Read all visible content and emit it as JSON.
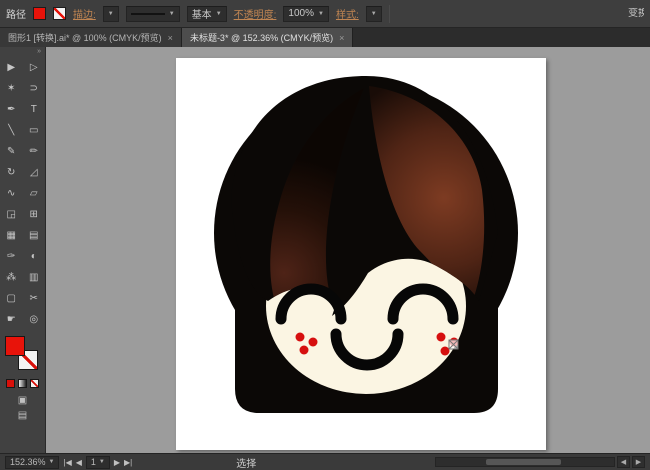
{
  "control_bar": {
    "selection_type": "路径",
    "stroke_label": "描边:",
    "brush_label": "基本",
    "opacity_label": "不透明度:",
    "opacity_value": "100%",
    "style_label": "样式:",
    "transform_label": "变换",
    "caret": "▼"
  },
  "tabs": [
    {
      "title": "图形1 [转换].ai* @ 100% (CMYK/预览)",
      "close": "×"
    },
    {
      "title": "未标题-3* @ 152.36% (CMYK/预览)",
      "close": "×"
    }
  ],
  "toolbar": {
    "collapse_glyph": "»",
    "tools": [
      {
        "name": "selection-tool",
        "glyph": "▶"
      },
      {
        "name": "direct-selection-tool",
        "glyph": "▷"
      },
      {
        "name": "magic-wand-tool",
        "glyph": "✶"
      },
      {
        "name": "lasso-tool",
        "glyph": "⊃"
      },
      {
        "name": "pen-tool",
        "glyph": "✒"
      },
      {
        "name": "type-tool",
        "glyph": "T"
      },
      {
        "name": "line-tool",
        "glyph": "╲"
      },
      {
        "name": "rectangle-tool",
        "glyph": "▭"
      },
      {
        "name": "paintbrush-tool",
        "glyph": "✎"
      },
      {
        "name": "pencil-tool",
        "glyph": "✏"
      },
      {
        "name": "rotate-tool",
        "glyph": "↻"
      },
      {
        "name": "scale-tool",
        "glyph": "◿"
      },
      {
        "name": "width-tool",
        "glyph": "∿"
      },
      {
        "name": "free-transform-tool",
        "glyph": "▱"
      },
      {
        "name": "shape-builder-tool",
        "glyph": "◲"
      },
      {
        "name": "perspective-grid-tool",
        "glyph": "⊞"
      },
      {
        "name": "mesh-tool",
        "glyph": "▦"
      },
      {
        "name": "gradient-tool",
        "glyph": "▤"
      },
      {
        "name": "eyedropper-tool",
        "glyph": "✑"
      },
      {
        "name": "blend-tool",
        "glyph": "◐"
      },
      {
        "name": "symbol-sprayer-tool",
        "glyph": "⁂"
      },
      {
        "name": "column-graph-tool",
        "glyph": "▥"
      },
      {
        "name": "artboard-tool",
        "glyph": "▢"
      },
      {
        "name": "slice-tool",
        "glyph": "✂"
      },
      {
        "name": "hand-tool",
        "glyph": "☛"
      },
      {
        "name": "zoom-tool",
        "glyph": "◎"
      }
    ]
  },
  "status_bar": {
    "zoom_value": "152.36%",
    "nav_first": "|◀",
    "nav_prev": "◀",
    "artboard_number": "1",
    "nav_next": "▶",
    "nav_last": "▶|",
    "status_text": "选择",
    "scroll_left": "◀",
    "scroll_right": "▶"
  },
  "artwork": {
    "hair_color": "#0b0806",
    "face_color": "#fbf5e3",
    "feature_color": "#070707",
    "cheek_dot_color": "#d60f0f",
    "bang_highlight": "#7d3b22",
    "bang_shadow": "#190c07",
    "bang_maroon": "#4e2317"
  }
}
